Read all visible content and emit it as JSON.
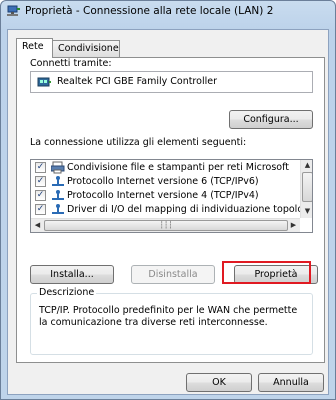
{
  "window": {
    "title": "Proprietà - Connessione alla rete locale (LAN) 2"
  },
  "tabs": [
    {
      "label": "Rete"
    },
    {
      "label": "Condivisione"
    }
  ],
  "connect_using": {
    "label": "Connetti tramite:",
    "adapter": "Realtek PCI GBE Family Controller",
    "configure_button": "Configura..."
  },
  "items_section": {
    "label": "La connessione utilizza gli elementi seguenti:",
    "items": [
      {
        "label": "Condivisione file e stampanti per reti Microsoft",
        "checked": true,
        "icon": "printer-share-icon"
      },
      {
        "label": "Protocollo Internet versione 6 (TCP/IPv6)",
        "checked": true,
        "icon": "protocol-icon"
      },
      {
        "label": "Protocollo Internet versione 4 (TCP/IPv4)",
        "checked": true,
        "icon": "protocol-icon"
      },
      {
        "label": "Driver di I/O del mapping di individuazione topologia liv",
        "checked": true,
        "icon": "protocol-icon"
      }
    ]
  },
  "buttons": {
    "install": "Installa...",
    "uninstall": "Disinstalla",
    "properties": "Proprietà"
  },
  "description": {
    "legend": "Descrizione",
    "text": "TCP/IP. Protocollo predefinito per le WAN che permette la comunicazione tra diverse reti interconnesse."
  },
  "footer": {
    "ok": "OK",
    "cancel": "Annulla"
  },
  "colors": {
    "highlight": "#e01a22"
  }
}
